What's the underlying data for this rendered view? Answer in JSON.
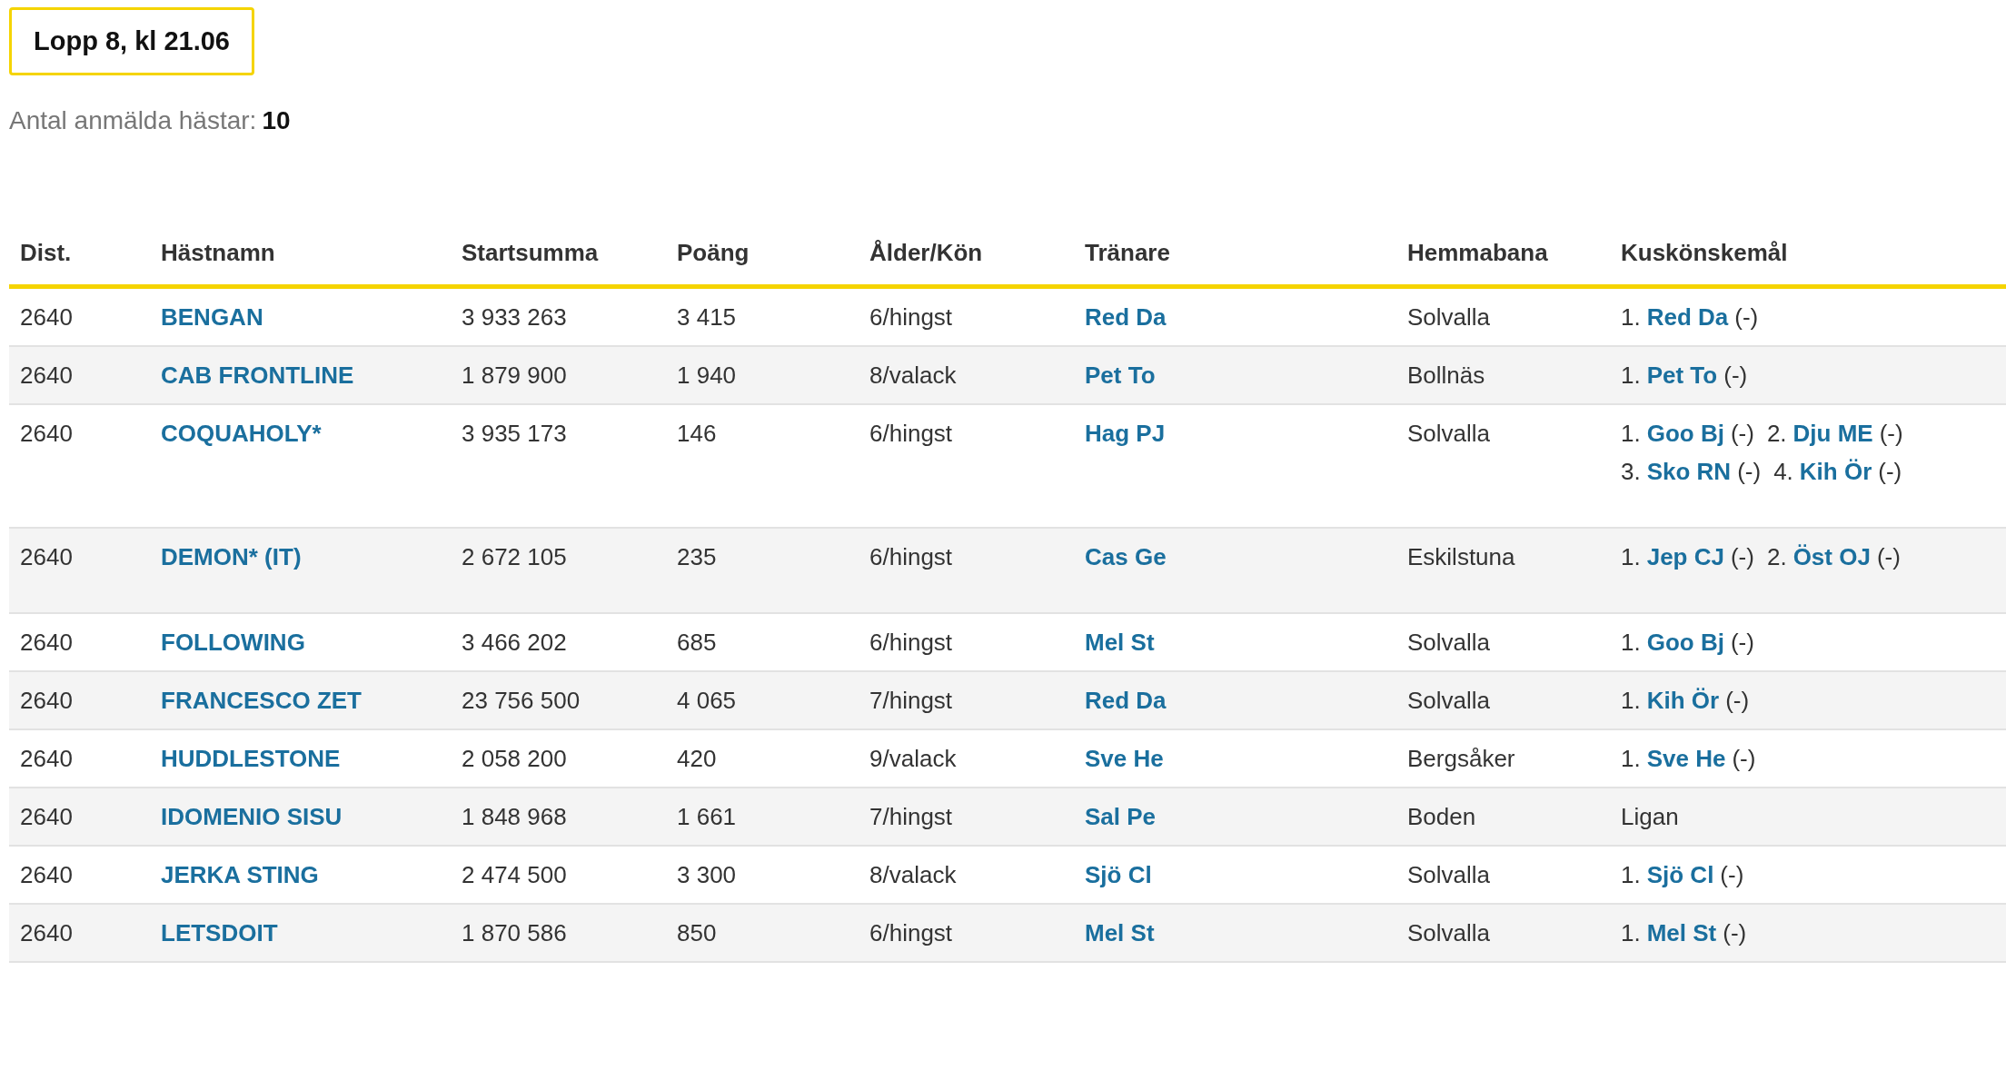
{
  "race_title": "Lopp 8, kl 21.06",
  "entries_label": "Antal anmälda hästar:",
  "entries_count": "10",
  "table": {
    "columns": [
      "Dist.",
      "Hästnamn",
      "Startsumma",
      "Poäng",
      "Ålder/Kön",
      "Tränare",
      "Hemmabana",
      "Kuskönskemål"
    ],
    "rows": [
      {
        "dist": "2640",
        "horse": "BENGAN",
        "prize": "3 933 263",
        "points": "3 415",
        "age_sex": "6/hingst",
        "trainer": "Red Da",
        "home": "Solvalla",
        "drivers": [
          {
            "number": "1.",
            "name": "Red Da",
            "note": "(-)"
          }
        ]
      },
      {
        "dist": "2640",
        "horse": "CAB FRONTLINE",
        "prize": "1 879 900",
        "points": "1 940",
        "age_sex": "8/valack",
        "trainer": "Pet To",
        "home": "Bollnäs",
        "drivers": [
          {
            "number": "1.",
            "name": "Pet To",
            "note": "(-)"
          }
        ]
      },
      {
        "dist": "2640",
        "horse": "COQUAHOLY*",
        "prize": "3 935 173",
        "points": "146",
        "age_sex": "6/hingst",
        "trainer": "Hag PJ",
        "home": "Solvalla",
        "drivers": [
          {
            "number": "1.",
            "name": "Goo Bj",
            "note": "(-)"
          },
          {
            "number": "2.",
            "name": "Dju ME",
            "note": "(-)"
          },
          {
            "number": "3.",
            "name": "Sko RN",
            "note": "(-)"
          },
          {
            "number": "4.",
            "name": "Kih Ör",
            "note": "(-)"
          }
        ]
      },
      {
        "dist": "2640",
        "horse": "DEMON* (IT)",
        "prize": "2 672 105",
        "points": "235",
        "age_sex": "6/hingst",
        "trainer": "Cas Ge",
        "home": "Eskilstuna",
        "drivers": [
          {
            "number": "1.",
            "name": "Jep CJ",
            "note": "(-)"
          },
          {
            "number": "2.",
            "name": "Öst OJ",
            "note": "(-)"
          }
        ]
      },
      {
        "dist": "2640",
        "horse": "FOLLOWING",
        "prize": "3 466 202",
        "points": "685",
        "age_sex": "6/hingst",
        "trainer": "Mel St",
        "home": "Solvalla",
        "drivers": [
          {
            "number": "1.",
            "name": "Goo Bj",
            "note": "(-)"
          }
        ]
      },
      {
        "dist": "2640",
        "horse": "FRANCESCO ZET",
        "prize": "23 756 500",
        "points": "4 065",
        "age_sex": "7/hingst",
        "trainer": "Red Da",
        "home": "Solvalla",
        "drivers": [
          {
            "number": "1.",
            "name": "Kih Ör",
            "note": "(-)"
          }
        ]
      },
      {
        "dist": "2640",
        "horse": "HUDDLESTONE",
        "prize": "2 058 200",
        "points": "420",
        "age_sex": "9/valack",
        "trainer": "Sve He",
        "home": "Bergsåker",
        "drivers": [
          {
            "number": "1.",
            "name": "Sve He",
            "note": "(-)"
          }
        ]
      },
      {
        "dist": "2640",
        "horse": "IDOMENIO SISU",
        "prize": "1 848 968",
        "points": "1 661",
        "age_sex": "7/hingst",
        "trainer": "Sal Pe",
        "home": "Boden",
        "driver_text": "Ligan"
      },
      {
        "dist": "2640",
        "horse": "JERKA STING",
        "prize": "2 474 500",
        "points": "3 300",
        "age_sex": "8/valack",
        "trainer": "Sjö Cl",
        "home": "Solvalla",
        "drivers": [
          {
            "number": "1.",
            "name": "Sjö Cl",
            "note": "(-)"
          }
        ]
      },
      {
        "dist": "2640",
        "horse": "LETSDOIT",
        "prize": "1 870 586",
        "points": "850",
        "age_sex": "6/hingst",
        "trainer": "Mel St",
        "home": "Solvalla",
        "drivers": [
          {
            "number": "1.",
            "name": "Mel St",
            "note": "(-)"
          }
        ]
      }
    ]
  }
}
